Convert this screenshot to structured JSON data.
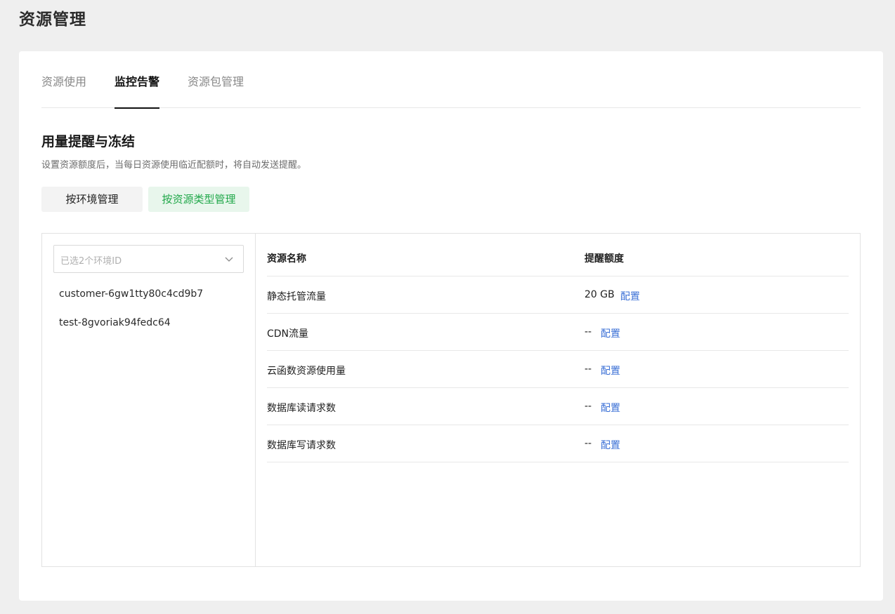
{
  "page_title": "资源管理",
  "tabs": [
    {
      "label": "资源使用",
      "active": false
    },
    {
      "label": "监控告警",
      "active": true
    },
    {
      "label": "资源包管理",
      "active": false
    }
  ],
  "section": {
    "title": "用量提醒与冻结",
    "description": "设置资源额度后，当每日资源使用临近配额时，将自动发送提醒。"
  },
  "mode_buttons": {
    "by_env": "按环境管理",
    "by_type": "按资源类型管理",
    "selected": "by_type"
  },
  "env_select": {
    "placeholder": "已选2个环境ID"
  },
  "env_list": [
    "customer-6gw1tty80c4cd9b7",
    "test-8gvoriak94fedc64"
  ],
  "table": {
    "headers": {
      "name": "资源名称",
      "quota": "提醒额度"
    },
    "config_label": "配置",
    "rows": [
      {
        "name": "静态托管流量",
        "quota": "20 GB"
      },
      {
        "name": "CDN流量",
        "quota": "--"
      },
      {
        "name": "云函数资源使用量",
        "quota": "--"
      },
      {
        "name": "数据库读请求数",
        "quota": "--"
      },
      {
        "name": "数据库写请求数",
        "quota": "--"
      }
    ]
  },
  "colors": {
    "accent_green": "#21a84a",
    "link_blue": "#3a6fd6"
  }
}
